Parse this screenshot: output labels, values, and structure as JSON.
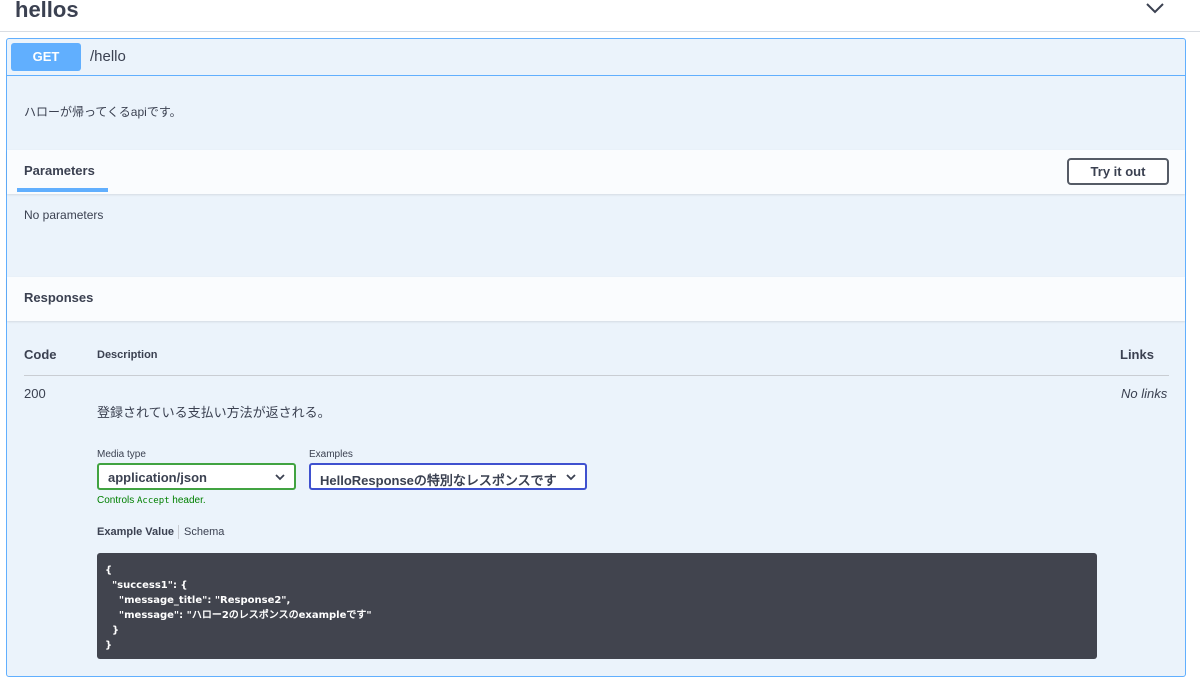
{
  "tag": {
    "title": "hellos",
    "toggle_icon": "chevron-down-icon"
  },
  "operation": {
    "method": "GET",
    "path": "/hello",
    "description": "ハローが帰ってくるapiです。",
    "colors": {
      "method_bg": "#61affe",
      "block_bg": "#ebf3fb",
      "border": "#61affe"
    }
  },
  "parameters": {
    "title": "Parameters",
    "try_button": "Try it out",
    "empty_text": "No parameters"
  },
  "responses": {
    "title": "Responses",
    "columns": {
      "code": "Code",
      "description": "Description",
      "links": "Links"
    },
    "rows": [
      {
        "code": "200",
        "description": "登録されている支払い方法が返される。",
        "links": "No links",
        "media_type_label": "Media type",
        "media_type_value": "application/json",
        "examples_label": "Examples",
        "examples_value": "HelloResponseの特別なレスポンスです",
        "controls_note_prefix": "Controls ",
        "controls_note_code": "Accept",
        "controls_note_suffix": " header.",
        "example_tabs": {
          "active": "Example Value",
          "inactive": "Schema"
        },
        "example_code": "{\n  \"success1\": {\n    \"message_title\": \"Response2\",\n    \"message\": \"ハロー2のレスポンスのexampleです\"\n  }\n}"
      }
    ]
  }
}
